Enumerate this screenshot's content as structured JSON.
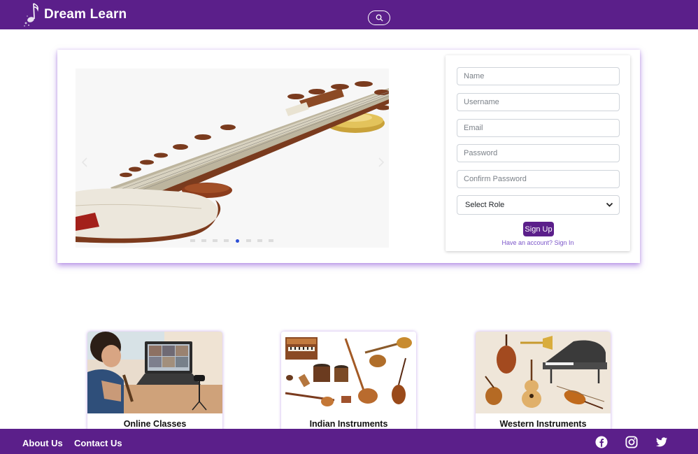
{
  "header": {
    "brand_name": "Dream Learn",
    "logo_icon": "music-note-icon",
    "search_icon": "search-icon"
  },
  "carousel": {
    "slide_count": 8,
    "active_index": 4,
    "prev_icon": "chevron-left-icon",
    "next_icon": "chevron-right-icon"
  },
  "signup": {
    "name_placeholder": "Name",
    "username_placeholder": "Username",
    "email_placeholder": "Email",
    "password_placeholder": "Password",
    "confirm_password_placeholder": "Confirm Password",
    "role_selected": "Select Role",
    "submit_label": "Sign Up",
    "signin_text": "Have an account? Sign In"
  },
  "features": [
    {
      "title": "Online Classes"
    },
    {
      "title": "Indian Instruments"
    },
    {
      "title": "Western Instruments"
    }
  ],
  "footer": {
    "about_label": "About Us",
    "contact_label": "Contact Us",
    "social_icons": [
      "facebook-icon",
      "instagram-icon",
      "twitter-icon"
    ]
  },
  "colors": {
    "brand_purple": "#5b1f8a",
    "card_glow": "#8549d3",
    "link_purple": "#7b55c9",
    "indicator_active": "#2d4fd6"
  }
}
